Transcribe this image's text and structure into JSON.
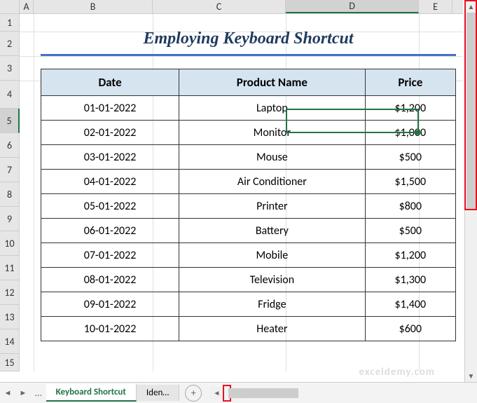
{
  "columns": [
    "A",
    "B",
    "C",
    "D",
    "E"
  ],
  "rows": [
    "1",
    "2",
    "3",
    "4",
    "5",
    "6",
    "7",
    "8",
    "9",
    "10",
    "11",
    "12",
    "13",
    "14",
    "15"
  ],
  "selected_column": "D",
  "selected_row": "5",
  "title": "Employing Keyboard Shortcut",
  "headers": {
    "date": "Date",
    "product": "Product Name",
    "price": "Price"
  },
  "chart_data": {
    "type": "table",
    "columns": [
      "Date",
      "Product Name",
      "Price"
    ],
    "rows": [
      {
        "date": "01-01-2022",
        "product": "Laptop",
        "price": "$1,200"
      },
      {
        "date": "02-01-2022",
        "product": "Monitor",
        "price": "$1,000"
      },
      {
        "date": "03-01-2022",
        "product": "Mouse",
        "price": "$500"
      },
      {
        "date": "04-01-2022",
        "product": "Air Conditioner",
        "price": "$1,500"
      },
      {
        "date": "05-01-2022",
        "product": "Printer",
        "price": "$800"
      },
      {
        "date": "06-01-2022",
        "product": "Battery",
        "price": "$500"
      },
      {
        "date": "07-01-2022",
        "product": "Mobile",
        "price": "$1,200"
      },
      {
        "date": "08-01-2022",
        "product": "Television",
        "price": "$1,300"
      },
      {
        "date": "09-01-2022",
        "product": "Fridge",
        "price": "$1,400"
      },
      {
        "date": "10-01-2022",
        "product": "Heater",
        "price": "$600"
      }
    ]
  },
  "tabs": {
    "active": "Keyboard Shortcut",
    "next": "Iden…",
    "dots": "…"
  },
  "watermark": "exceldemy.com",
  "nav": {
    "prev": "◄",
    "next": "►",
    "up": "▲",
    "down": "▼",
    "left": "◄",
    "right": "►",
    "add": "+"
  }
}
